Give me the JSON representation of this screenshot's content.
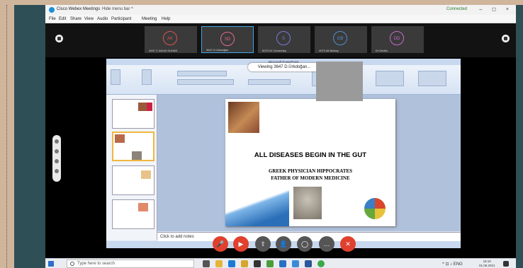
{
  "webex": {
    "app_title": "Cisco Webex Meetings",
    "hide_menu": "Hide menu bar ^",
    "connection_status": "Connected",
    "window_controls": "– ◻ ×",
    "menu": [
      "File",
      "Edit",
      "Share",
      "View",
      "Audio",
      "Participant",
      "Meeting",
      "Help"
    ],
    "participants": [
      {
        "initials": "AK",
        "color": "#d9534f",
        "name": "4007 C.AKUN SUHAN"
      },
      {
        "initials": "SD",
        "color": "#e26a8a",
        "name": "3647 D.Ürkdoğan"
      },
      {
        "initials": "S",
        "color": "#7a7ad9",
        "name": "5070 Dr Cömerdeş"
      },
      {
        "initials": "GB",
        "color": "#4f8fd1",
        "name": "4072 Ali Bektaş"
      },
      {
        "initials": "DD",
        "color": "#c86ad0",
        "name": "Dr Devita"
      }
    ],
    "viewing_label": "Viewing 3647 D.Ürkdoğan...",
    "controls": [
      {
        "name": "mute",
        "symbol": "🎤",
        "color": "#e0402e"
      },
      {
        "name": "video",
        "symbol": "▶",
        "color": "#e0402e"
      },
      {
        "name": "share",
        "symbol": "⇧",
        "color": "#555"
      },
      {
        "name": "participants",
        "symbol": "👤",
        "color": "#555"
      },
      {
        "name": "chat",
        "symbol": "◯",
        "color": "#555"
      },
      {
        "name": "more",
        "symbol": "…",
        "color": "#555"
      },
      {
        "name": "leave",
        "symbol": "✕",
        "color": "#e0402e"
      }
    ]
  },
  "powerpoint": {
    "title_bar": "Microsoft PowerPoint",
    "notes_placeholder": "Click to add notes",
    "slide": {
      "heading": "ALL DISEASES BEGIN IN THE GUT",
      "line1": "GREEK PHYSICIAN HIPPOCRATES",
      "line2": "FATHER OF MODERN MEDICINE"
    }
  },
  "taskbar": {
    "search_placeholder": "Type here to search",
    "tray": "^ ⊡ ♪ ENG",
    "time": "18:10",
    "date": "01.06.2021",
    "apps": [
      {
        "name": "task-view",
        "color": "#555"
      },
      {
        "name": "file-explorer",
        "color": "#e8b33a"
      },
      {
        "name": "edge",
        "color": "#1b7ad6"
      },
      {
        "name": "folder",
        "color": "#d9a52a"
      },
      {
        "name": "store",
        "color": "#333"
      },
      {
        "name": "chrome",
        "color": "#4a9d3a"
      },
      {
        "name": "webex",
        "color": "#2a6fc4"
      },
      {
        "name": "photos",
        "color": "#3a8ad9"
      },
      {
        "name": "word",
        "color": "#2b579a"
      },
      {
        "name": "teams-app",
        "color": "#3aa94a"
      }
    ]
  }
}
